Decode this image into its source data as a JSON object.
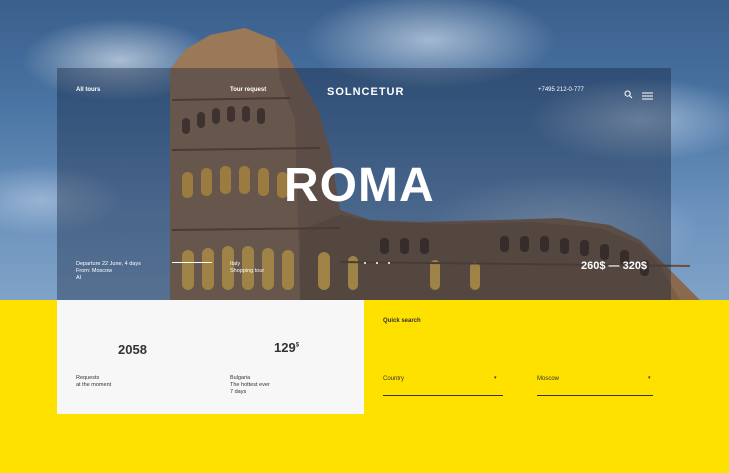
{
  "nav": {
    "all_tours": "All tours",
    "tour_request": "Tour request",
    "brand": "SOLNCETUR",
    "phone": "+7495 212-0-777",
    "search_icon": "search-icon",
    "menu_icon": "hamburger-menu-icon"
  },
  "hero": {
    "title": "ROMA",
    "departure": "Departure 22 June, 4 days",
    "from": "From: Moscow",
    "airline": "AI",
    "country": "Italy",
    "tour_type": "Shopping tour",
    "price_range": "260$ — 320$"
  },
  "stats": {
    "requests_value": "2058",
    "requests_label_1": "Requests",
    "requests_label_2": "at the moment",
    "bulgaria_value": "129",
    "bulgaria_currency": "$",
    "bulgaria_label_1": "Bulgaria",
    "bulgaria_label_2": "The hottest ever",
    "bulgaria_label_3": "7 days"
  },
  "quick_search": {
    "title": "Quick search",
    "country_label": "Country",
    "city_label": "Moscow"
  },
  "colors": {
    "accent_yellow": "#ffe100",
    "card_white": "#f7f7f7",
    "text_dark": "#333333"
  }
}
